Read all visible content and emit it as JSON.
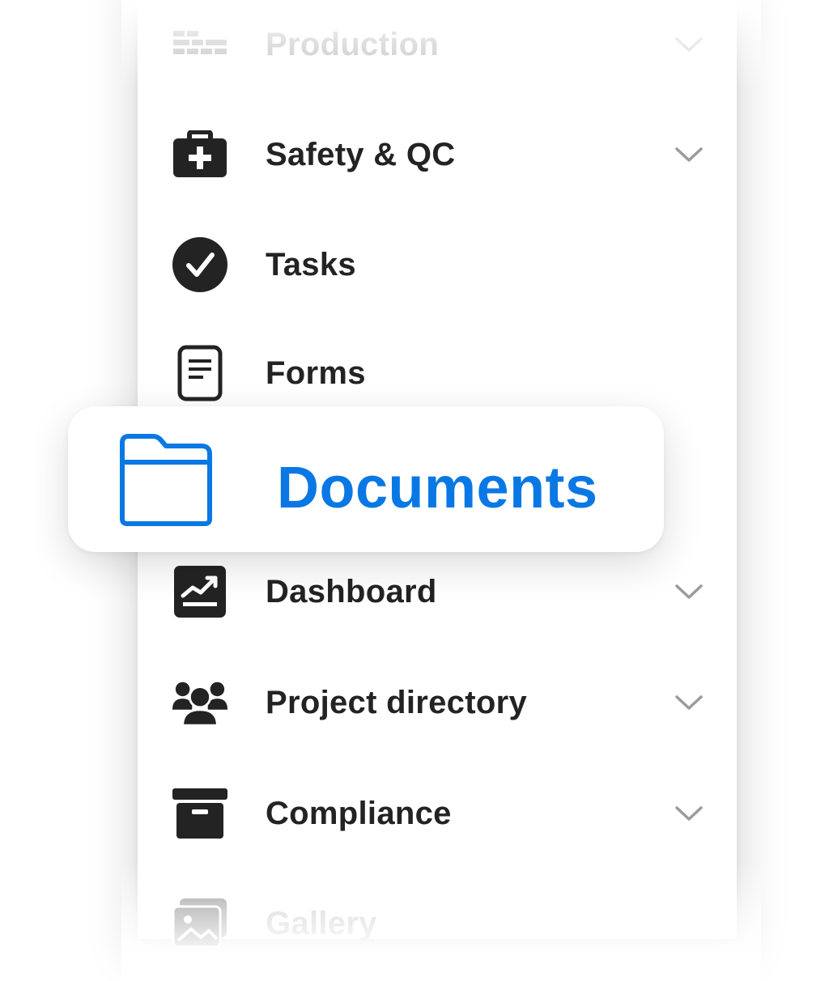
{
  "menu": {
    "items": [
      {
        "label": "Production",
        "icon": "production-icon",
        "expandable": true
      },
      {
        "label": "Safety & QC",
        "icon": "first-aid-kit-icon",
        "expandable": true
      },
      {
        "label": "Tasks",
        "icon": "check-circle-icon",
        "expandable": false
      },
      {
        "label": "Forms",
        "icon": "form-document-icon",
        "expandable": false
      },
      {
        "label": "Dashboard",
        "icon": "chart-trend-icon",
        "expandable": true
      },
      {
        "label": "Project directory",
        "icon": "people-group-icon",
        "expandable": true
      },
      {
        "label": "Compliance",
        "icon": "archive-box-icon",
        "expandable": true
      },
      {
        "label": "Gallery",
        "icon": "gallery-icon",
        "expandable": false
      }
    ],
    "highlighted": {
      "label": "Documents",
      "icon": "folder-icon"
    }
  },
  "colors": {
    "accent": "#0a78e4",
    "text": "#232323",
    "chevron": "#9b9b9b",
    "faded_text": "#bdbdbd"
  }
}
